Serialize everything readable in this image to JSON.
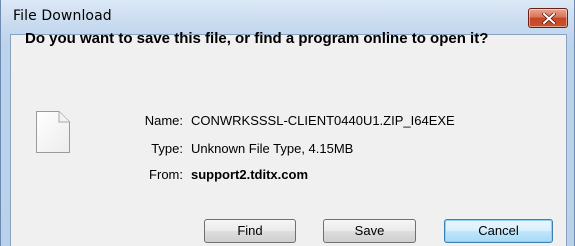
{
  "window": {
    "title": "File Download",
    "close_icon": "close-x-icon"
  },
  "dialog": {
    "question": "Do you want to save this file, or find a program online to open it?",
    "file_icon": "blank-document-icon",
    "name_label": "Name:",
    "name_value": "CONWRKSSSL-CLIENT0440U1.ZIP_I64EXE",
    "type_label": "Type:",
    "type_value": "Unknown File Type, 4.15MB",
    "from_label": "From:",
    "from_value": "support2.tditx.com"
  },
  "buttons": {
    "find": "Find",
    "save": "Save",
    "cancel": "Cancel"
  },
  "colors": {
    "frame": "#b9d1ea",
    "client": "#f0f0f0",
    "close_button": "#c74726",
    "default_button_border": "#3c7fb1"
  }
}
